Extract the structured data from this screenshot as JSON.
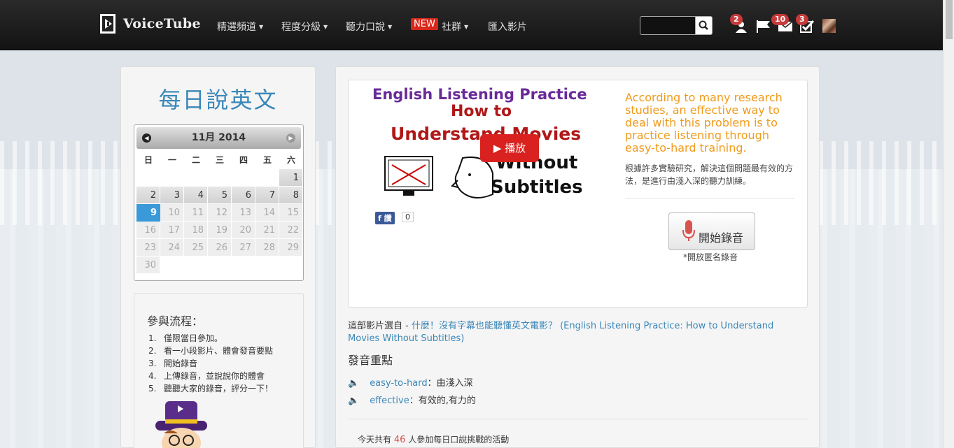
{
  "navbar": {
    "logo_text": "VoiceTube",
    "items": [
      {
        "label": "精選頻道",
        "has_caret": true
      },
      {
        "label": "程度分級",
        "has_caret": true
      },
      {
        "label": "聽力口說",
        "has_caret": true
      },
      {
        "label": "社群",
        "has_caret": true
      },
      {
        "label": "匯入影片",
        "has_caret": false
      }
    ],
    "new_badge": "NEW",
    "search": {
      "placeholder": "",
      "value": ""
    },
    "notifications": [
      {
        "icon": "user-icon",
        "count": "2"
      },
      {
        "icon": "flag-icon",
        "count": ""
      },
      {
        "icon": "envelope-icon",
        "count": "10"
      },
      {
        "icon": "checkbox-icon",
        "count": "3"
      }
    ]
  },
  "sidebar": {
    "title": "每日說英文",
    "calendar": {
      "month_label": "11月 2014",
      "weekdays": [
        "日",
        "一",
        "二",
        "三",
        "四",
        "五",
        "六"
      ],
      "today": "9",
      "weeks": [
        [
          "",
          "",
          "",
          "",
          "",
          "",
          "1"
        ],
        [
          "2",
          "3",
          "4",
          "5",
          "6",
          "7",
          "8"
        ],
        [
          "9",
          "10",
          "11",
          "12",
          "13",
          "14",
          "15"
        ],
        [
          "16",
          "17",
          "18",
          "19",
          "20",
          "21",
          "22"
        ],
        [
          "23",
          "24",
          "25",
          "26",
          "27",
          "28",
          "29"
        ],
        [
          "30",
          "",
          "",
          "",
          "",
          "",
          ""
        ]
      ]
    },
    "flow": {
      "title": "參與流程：",
      "steps": [
        "僅限當日參加。",
        "看一小段影片、體會發音要點",
        "開始錄音",
        "上傳錄音，並說說你的體會",
        "聽聽大家的錄音，評分一下！"
      ]
    }
  },
  "main": {
    "thumbnail": {
      "line1": "English Listening Practice",
      "line2": "How to",
      "line3": "Understand Movies",
      "line4": "Without",
      "line5": "Subtitles"
    },
    "play_label": "播放",
    "fb_label": "讚",
    "fb_count": "0",
    "quote_en": "According to many research studies, an effective way to deal with this problem is to practice listening through easy-to-hard training.",
    "quote_zh": "根據許多實驗研究，解決這個問題最有效的方法，是進行由淺入深的聽力訓練。",
    "record_label": "開始錄音",
    "record_note": "*開放匿名錄音",
    "source_prefix": "這部影片選自 - ",
    "source_link": "什麼！沒有字幕也能聽懂英文電影？ (English Listening Practice: How to Understand Movies Without Subtitles)",
    "key_points_title": "發音重點",
    "words": [
      {
        "word": "easy-to-hard",
        "meaning": "：由淺入深"
      },
      {
        "word": "effective",
        "meaning": "：有效的,有力的"
      }
    ],
    "today": {
      "prefix": "今天共有",
      "count": "46",
      "suffix": "人參加每日口說挑戰的活動"
    }
  }
}
